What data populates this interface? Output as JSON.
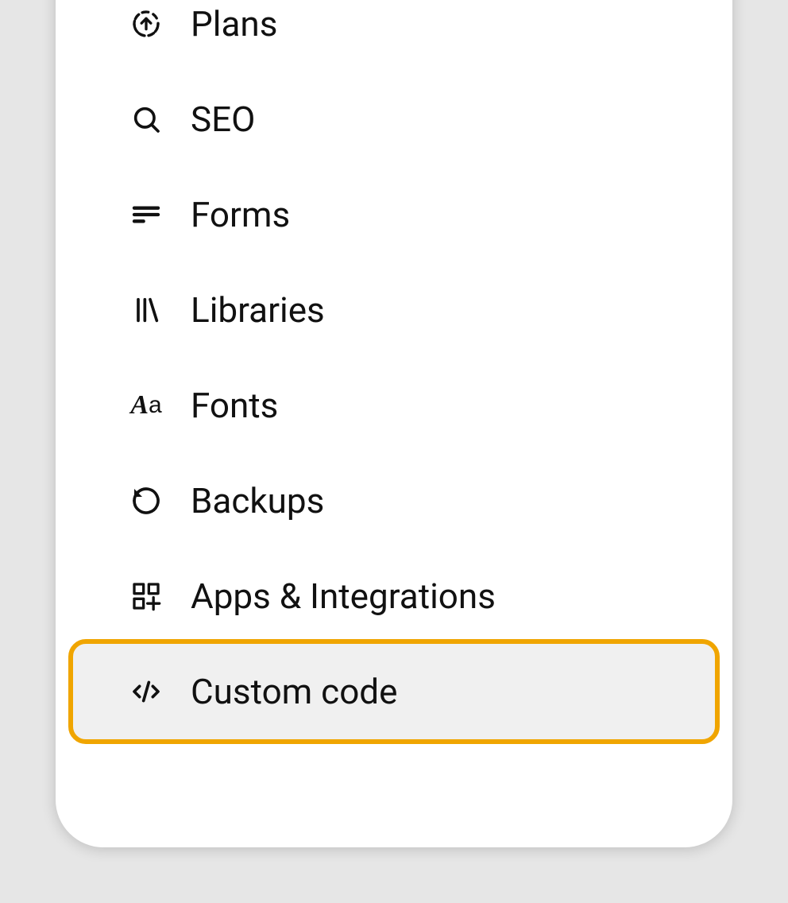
{
  "sidebar": {
    "items": [
      {
        "label": "Plans",
        "icon": "upload-circle-icon",
        "highlighted": false
      },
      {
        "label": "SEO",
        "icon": "search-icon",
        "highlighted": false
      },
      {
        "label": "Forms",
        "icon": "forms-icon",
        "highlighted": false
      },
      {
        "label": "Libraries",
        "icon": "libraries-icon",
        "highlighted": false
      },
      {
        "label": "Fonts",
        "icon": "fonts-icon",
        "highlighted": false
      },
      {
        "label": "Backups",
        "icon": "undo-icon",
        "highlighted": false
      },
      {
        "label": "Apps & Integrations",
        "icon": "apps-icon",
        "highlighted": false
      },
      {
        "label": "Custom code",
        "icon": "code-icon",
        "highlighted": true
      }
    ]
  },
  "colors": {
    "highlight_border": "#f0a500",
    "highlight_bg": "#f0f0f0",
    "panel_bg": "#ffffff",
    "page_bg": "#e6e6e6"
  }
}
